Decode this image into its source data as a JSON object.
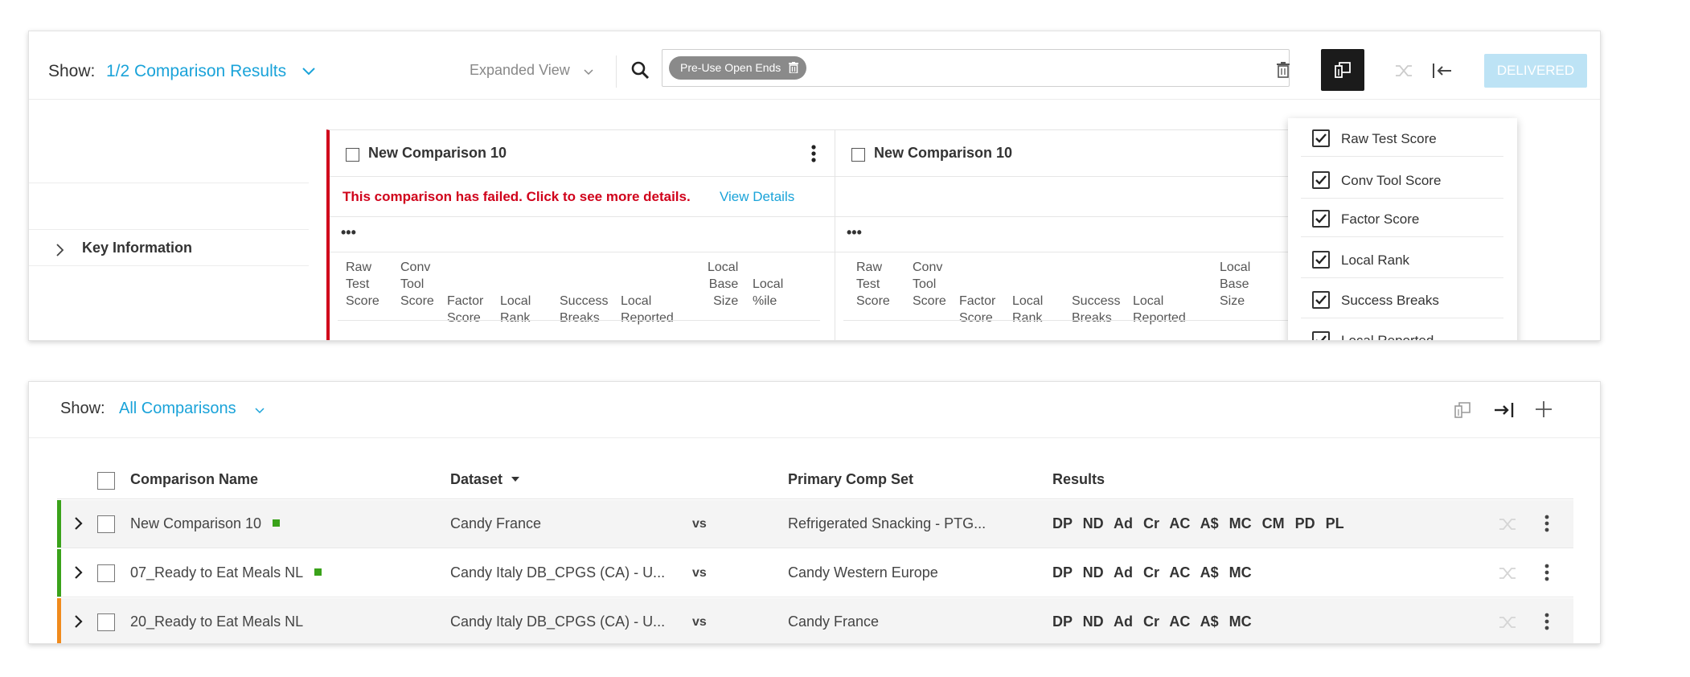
{
  "top_panel": {
    "show_label": "Show:",
    "show_value": "1/2 Comparison Results",
    "view_mode": "Expanded View",
    "search_chip": "Pre-Use Open Ends",
    "delivered_button": "DELIVERED",
    "key_information": "Key Information",
    "cards": [
      {
        "title": "New Comparison 10",
        "error_message": "This comparison has failed. Click to see more details.",
        "view_details": "View Details",
        "ellipsis": "•••",
        "columns": [
          "Raw\nTest\nScore",
          "Conv\nTool\nScore",
          "Factor\nScore",
          "Local\nRank",
          "Success\nBreaks",
          "Local\nReported",
          "Local\nBase\nSize",
          "Local\n%ile"
        ]
      },
      {
        "title": "New Comparison 10",
        "ellipsis": "•••",
        "columns": [
          "Raw\nTest\nScore",
          "Conv\nTool\nScore",
          "Factor\nScore",
          "Local\nRank",
          "Success\nBreaks",
          "Local\nReported",
          "Local\nBase\nSize"
        ]
      }
    ],
    "column_dropdown": {
      "items": [
        {
          "label": "Raw Test Score",
          "checked": true
        },
        {
          "label": "Conv Tool Score",
          "checked": true
        },
        {
          "label": "Factor Score",
          "checked": true
        },
        {
          "label": "Local Rank",
          "checked": true
        },
        {
          "label": "Success Breaks",
          "checked": true
        },
        {
          "label": "Local Reported",
          "checked": true
        }
      ]
    }
  },
  "bottom_panel": {
    "show_label": "Show:",
    "show_value": "All Comparisons",
    "table": {
      "headers": {
        "name": "Comparison Name",
        "dataset": "Dataset",
        "primary": "Primary Comp Set",
        "results": "Results"
      },
      "rows": [
        {
          "name": "New Comparison 10",
          "dataset": "Candy France",
          "vs": "vs",
          "primary": "Refrigerated Snacking - PTG...",
          "results": "DP ND Ad Cr AC A$ MC CM PD PL",
          "status_color": "#3aa21a"
        },
        {
          "name": "07_Ready to Eat Meals NL",
          "dataset": "Candy Italy DB_CPGS (CA) - U...",
          "vs": "vs",
          "primary": "Candy Western Europe",
          "results": "DP ND Ad Cr AC A$ MC",
          "status_color": "#3aa21a"
        },
        {
          "name": "20_Ready to Eat Meals NL",
          "dataset": "Candy Italy DB_CPGS (CA) - U...",
          "vs": "vs",
          "primary": "Candy France",
          "results": "DP ND Ad Cr AC A$ MC",
          "status_color": "#f08a1c"
        }
      ]
    }
  },
  "colors": {
    "accent": "#1aa3d9",
    "error": "#d0021b",
    "success": "#3aa21a",
    "warning": "#f08a1c",
    "delivered_button": "#bde3f5"
  },
  "icons": [
    "chevron-down-icon",
    "search-icon",
    "trash-icon",
    "columns-icon",
    "shuffle-icon",
    "collapse-left-icon",
    "expand-right-icon",
    "plus-icon",
    "kebab-icon",
    "chevron-right-icon",
    "checkbox-icon",
    "sort-caret-icon"
  ]
}
